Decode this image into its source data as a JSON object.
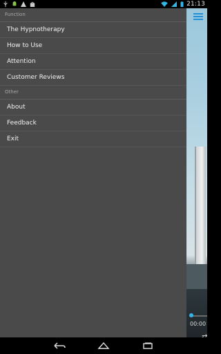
{
  "status_bar": {
    "time": "21:13",
    "icons_left": [
      "usb-icon",
      "android-icon",
      "warning-icon",
      "bag-icon"
    ],
    "icons_right": [
      "wifi-icon",
      "signal-icon",
      "battery-icon"
    ]
  },
  "drawer": {
    "sections": [
      {
        "header": "Function",
        "items": [
          "The Hypnotherapy",
          "How to Use",
          "Attention",
          "Customer Reviews"
        ]
      },
      {
        "header": "Other",
        "items": [
          "About",
          "Feedback",
          "Exit"
        ]
      }
    ]
  },
  "background_app": {
    "player_time": "00:00",
    "menu_icon": "hamburger-icon",
    "accent_color": "#1f8fd8"
  },
  "nav_bar": {
    "buttons": [
      "back-icon",
      "home-icon",
      "recent-apps-icon"
    ]
  }
}
